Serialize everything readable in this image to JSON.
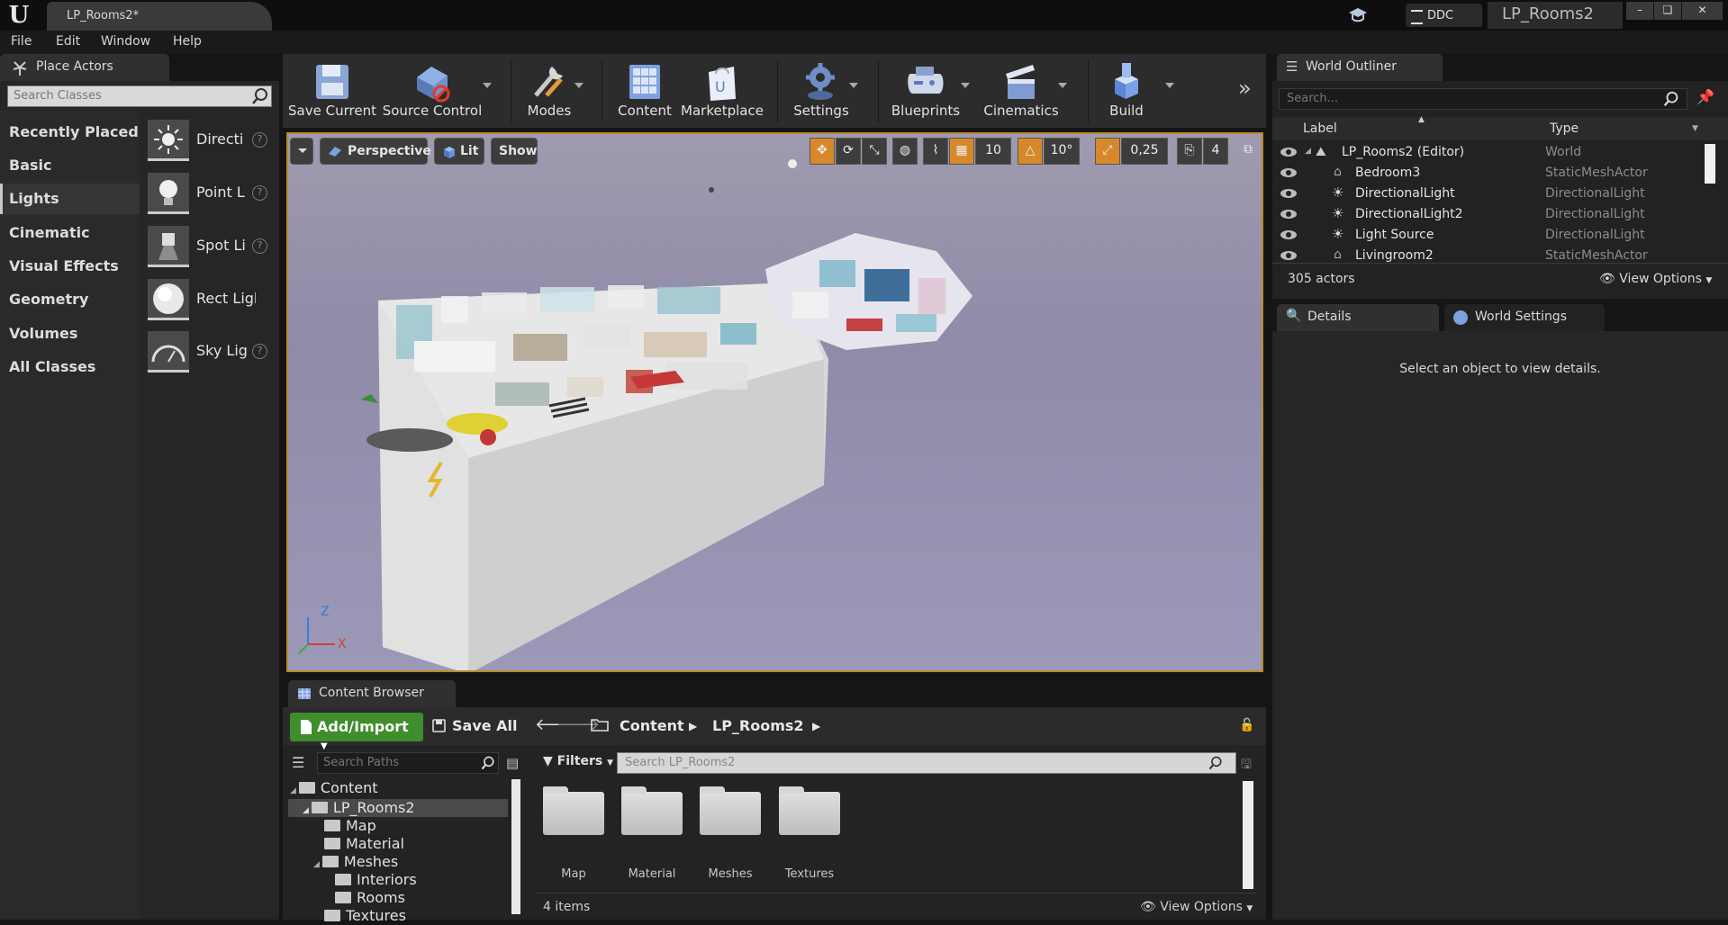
{
  "window": {
    "document_tab": "LP_Rooms2*",
    "ddc_label": "DDC",
    "project_name": "LP_Rooms2",
    "min": "–",
    "max": "❑",
    "close": "✕"
  },
  "menu": [
    "File",
    "Edit",
    "Window",
    "Help"
  ],
  "place_actors": {
    "tab_label": "Place Actors",
    "search_placeholder": "Search Classes",
    "categories": [
      "Recently Placed",
      "Basic",
      "Lights",
      "Cinematic",
      "Visual Effects",
      "Geometry",
      "Volumes",
      "All Classes"
    ],
    "selected_category": "Lights",
    "items": [
      {
        "label": "Directi",
        "icon": "directional-light-icon"
      },
      {
        "label": "Point L",
        "icon": "point-light-icon"
      },
      {
        "label": "Spot Li",
        "icon": "spot-light-icon"
      },
      {
        "label": "Rect Light",
        "icon": "rect-light-icon"
      },
      {
        "label": "Sky Lig",
        "icon": "sky-light-icon"
      }
    ],
    "help_glyph": "?"
  },
  "toolbar": {
    "items": [
      {
        "label": "Save Current",
        "icon": "save-icon"
      },
      {
        "label": "Source Control",
        "icon": "source-control-icon"
      },
      {
        "label": "Modes",
        "icon": "modes-icon"
      },
      {
        "label": "Content",
        "icon": "content-icon"
      },
      {
        "label": "Marketplace",
        "icon": "marketplace-icon"
      },
      {
        "label": "Settings",
        "icon": "settings-icon"
      },
      {
        "label": "Blueprints",
        "icon": "blueprints-icon"
      },
      {
        "label": "Cinematics",
        "icon": "cinematics-icon"
      },
      {
        "label": "Build",
        "icon": "build-icon"
      }
    ],
    "more": "»"
  },
  "viewport": {
    "perspective": "Perspective",
    "lit": "Lit",
    "show": "Show",
    "grid_snap": "10",
    "rot_snap": "10°",
    "scale_snap": "0,25",
    "cam_speed": "4",
    "axis_z": "Z",
    "axis_x": "X"
  },
  "content_browser": {
    "tab_label": "Content Browser",
    "add_import": "Add/Import",
    "save_all": "Save All",
    "breadcrumb": [
      "Content",
      "LP_Rooms2"
    ],
    "path_search_placeholder": "Search Paths",
    "filters": "Filters",
    "asset_search_placeholder": "Search LP_Rooms2",
    "tree": [
      {
        "label": "Content",
        "level": 0
      },
      {
        "label": "LP_Rooms2",
        "level": 1
      },
      {
        "label": "Map",
        "level": 2
      },
      {
        "label": "Material",
        "level": 2
      },
      {
        "label": "Meshes",
        "level": 2
      },
      {
        "label": "Interiors",
        "level": 3
      },
      {
        "label": "Rooms",
        "level": 3
      },
      {
        "label": "Textures",
        "level": 2
      }
    ],
    "assets": [
      "Map",
      "Material",
      "Meshes",
      "Textures"
    ],
    "items_count": "4 items",
    "view_options": "View Options"
  },
  "world_outliner": {
    "tab_label": "World Outliner",
    "search_placeholder": "Search...",
    "col_label": "Label",
    "col_type": "Type",
    "rows": [
      {
        "label": "LP_Rooms2 (Editor)",
        "type": "World"
      },
      {
        "label": "Bedroom3",
        "type": "StaticMeshActor"
      },
      {
        "label": "DirectionalLight",
        "type": "DirectionalLight"
      },
      {
        "label": "DirectionalLight2",
        "type": "DirectionalLight"
      },
      {
        "label": "Light Source",
        "type": "DirectionalLight"
      },
      {
        "label": "Livingroom2",
        "type": "StaticMeshActor"
      }
    ],
    "actor_count": "305 actors",
    "view_options": "View Options"
  },
  "details": {
    "tab_label": "Details",
    "world_settings_tab": "World Settings",
    "empty_message": "Select an object to view details."
  }
}
